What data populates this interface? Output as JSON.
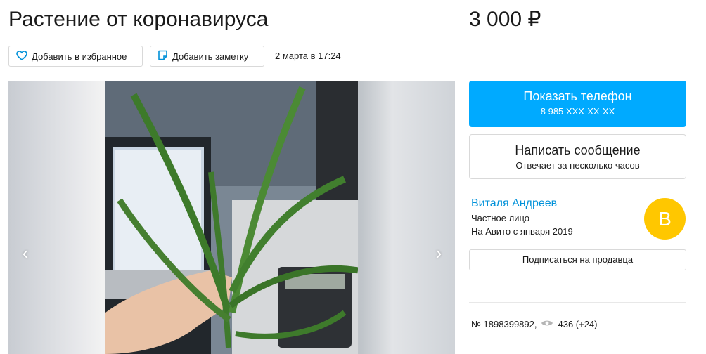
{
  "listing": {
    "title": "Растение от коронавируса",
    "price": "3 000 ₽",
    "date": "2 марта в 17:24",
    "id_text": "№ 1898399892,",
    "views": "436 (+24)"
  },
  "actions": {
    "favorite_label": "Добавить в избранное",
    "note_label": "Добавить заметку"
  },
  "contact": {
    "phone_title": "Показать телефон",
    "phone_masked": "8 985 XXX-XX-XX",
    "message_title": "Написать сообщение",
    "message_subtitle": "Отвечает за несколько часов"
  },
  "seller": {
    "name": "Виталя Андреев",
    "type": "Частное лицо",
    "since": "На Авито с января 2019",
    "avatar_letter": "В",
    "subscribe_label": "Подписаться на продавца"
  },
  "gallery": {
    "prev_glyph": "‹",
    "next_glyph": "›"
  },
  "icons": {
    "favorite": "heart-icon",
    "note": "note-icon",
    "views": "eye-icon"
  },
  "colors": {
    "accent": "#00aaff",
    "link": "#0091d9",
    "avatar": "#ffc700"
  }
}
